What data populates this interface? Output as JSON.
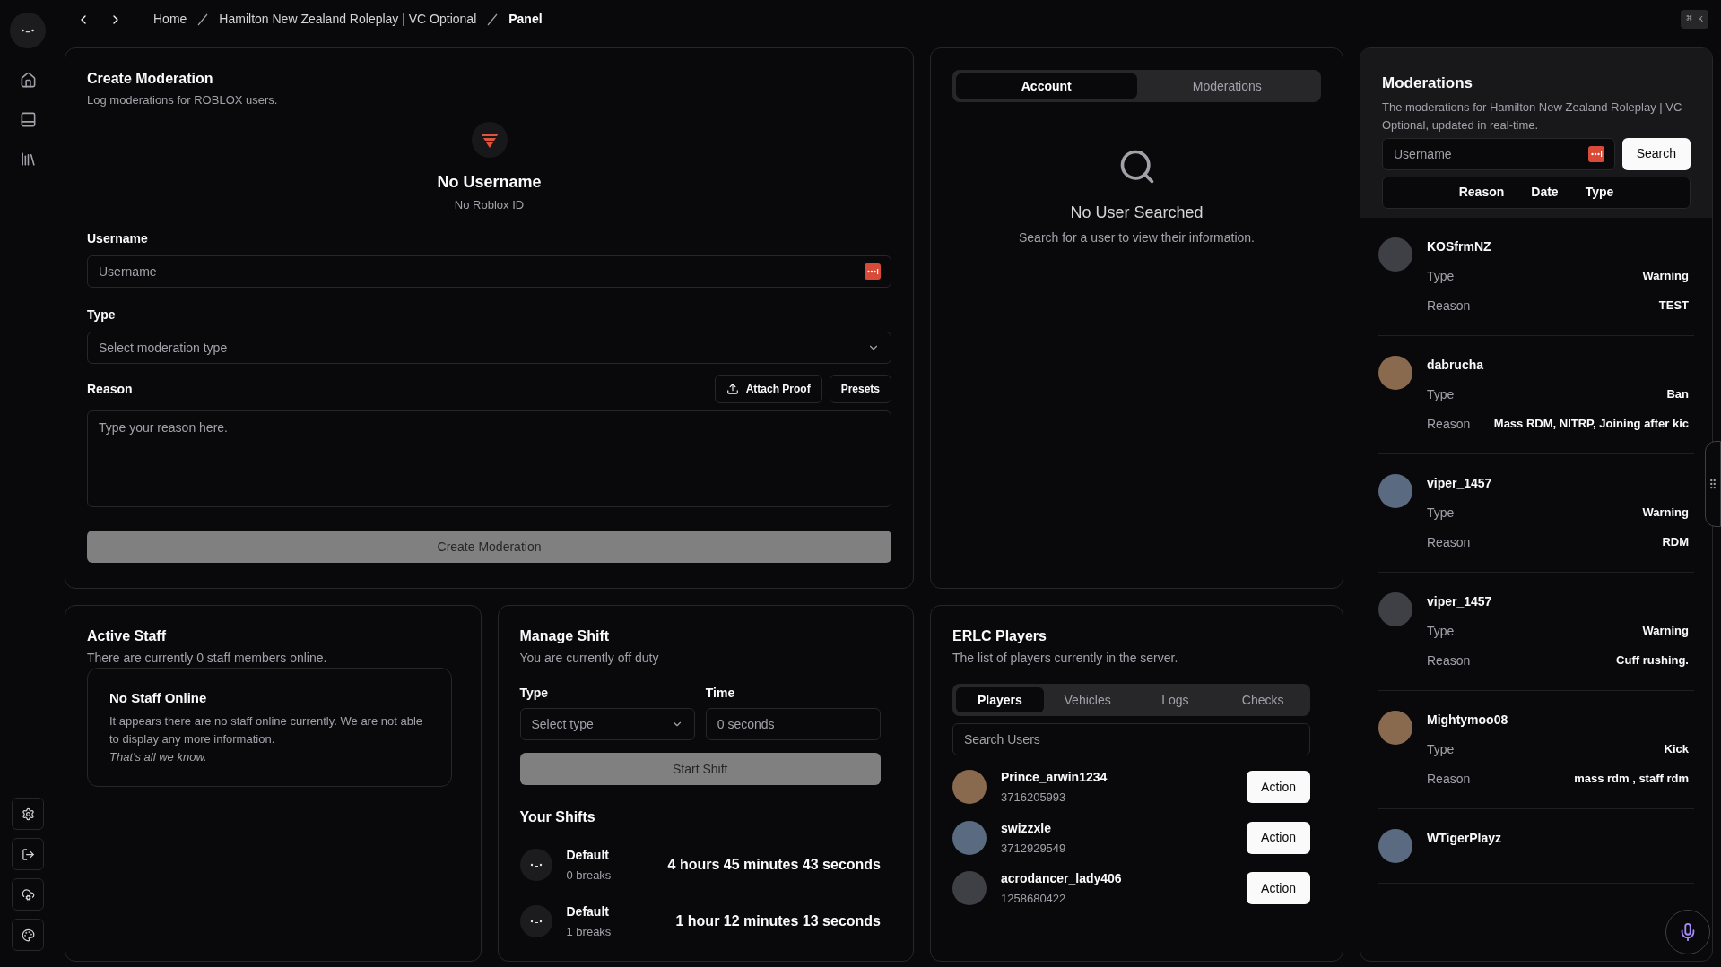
{
  "breadcrumbs": [
    {
      "label": "Home",
      "current": false
    },
    {
      "label": "Hamilton New Zealand Roleplay | VC Optional",
      "current": false
    },
    {
      "label": "Panel",
      "current": true
    }
  ],
  "shortcut": {
    "symbol": "⌘",
    "key": "K"
  },
  "create_moderation": {
    "title": "Create Moderation",
    "subtitle": "Log moderations for ROBLOX users.",
    "user_name": "No Username",
    "user_id": "No Roblox ID",
    "username_label": "Username",
    "username_placeholder": "Username",
    "type_label": "Type",
    "type_placeholder": "Select moderation type",
    "reason_label": "Reason",
    "attach_button": "Attach Proof",
    "presets_button": "Presets",
    "reason_placeholder": "Type your reason here.",
    "submit_button": "Create Moderation",
    "submit_disabled": true
  },
  "lookup": {
    "tabs": [
      {
        "label": "Account",
        "selected": true
      },
      {
        "label": "Moderations",
        "selected": false
      }
    ],
    "empty_title": "No User Searched",
    "empty_text": "Search for a user to view their information."
  },
  "moderations": {
    "title": "Moderations",
    "subtitle": "The moderations for Hamilton New Zealand Roleplay | VC Optional, updated in real-time.",
    "search_placeholder": "Username",
    "search_button": "Search",
    "columns": [
      "Reason",
      "Date",
      "Type"
    ],
    "items": [
      {
        "name": "KOSfrmNZ",
        "fields": [
          {
            "label": "Type",
            "value": "Warning"
          },
          {
            "label": "Reason",
            "value": "TEST"
          }
        ]
      },
      {
        "name": "dabrucha",
        "fields": [
          {
            "label": "Type",
            "value": "Ban"
          },
          {
            "label": "Reason",
            "value": "Mass RDM, NITRP, Joining after kic"
          }
        ]
      },
      {
        "name": "viper_1457",
        "fields": [
          {
            "label": "Type",
            "value": "Warning"
          },
          {
            "label": "Reason",
            "value": "RDM"
          }
        ]
      },
      {
        "name": "viper_1457",
        "fields": [
          {
            "label": "Type",
            "value": "Warning"
          },
          {
            "label": "Reason",
            "value": "Cuff rushing."
          }
        ]
      },
      {
        "name": "Mightymoo08",
        "fields": [
          {
            "label": "Type",
            "value": "Kick"
          },
          {
            "label": "Reason",
            "value": "mass rdm , staff rdm"
          }
        ]
      },
      {
        "name": "WTigerPlayz"
      }
    ]
  },
  "active_staff": {
    "title": "Active Staff",
    "subtitle": "There are currently 0 staff members online.",
    "empty_title": "No Staff Online",
    "empty_text": "It appears there are no staff online currently. We are not able to display any more information.",
    "empty_note": "That's all we know."
  },
  "manage_shift": {
    "title": "Manage Shift",
    "subtitle": "You are currently off duty",
    "type_label": "Type",
    "type_placeholder": "Select type",
    "time_label": "Time",
    "time_value": "0 seconds",
    "start_button": "Start Shift",
    "start_disabled": true,
    "shifts_title": "Your Shifts",
    "shifts": [
      {
        "type": "Default",
        "breaks": "0 breaks",
        "duration": "4 hours 45 minutes 43 seconds"
      },
      {
        "type": "Default",
        "breaks": "1 breaks",
        "duration": "1 hour 12 minutes 13 seconds"
      }
    ]
  },
  "erlc_players": {
    "title": "ERLC Players",
    "subtitle": "The list of players currently in the server.",
    "tabs": [
      {
        "label": "Players",
        "selected": true
      },
      {
        "label": "Vehicles",
        "selected": false
      },
      {
        "label": "Logs",
        "selected": false
      },
      {
        "label": "Checks",
        "selected": false
      }
    ],
    "search_placeholder": "Search Users",
    "players": [
      {
        "name": "Prince_arwin1234",
        "id": "3716205993",
        "action": "Action"
      },
      {
        "name": "swizzxle",
        "id": "3712929549",
        "action": "Action"
      },
      {
        "name": "acrodancer_lady406",
        "id": "1258680422",
        "action": "Action"
      }
    ]
  }
}
